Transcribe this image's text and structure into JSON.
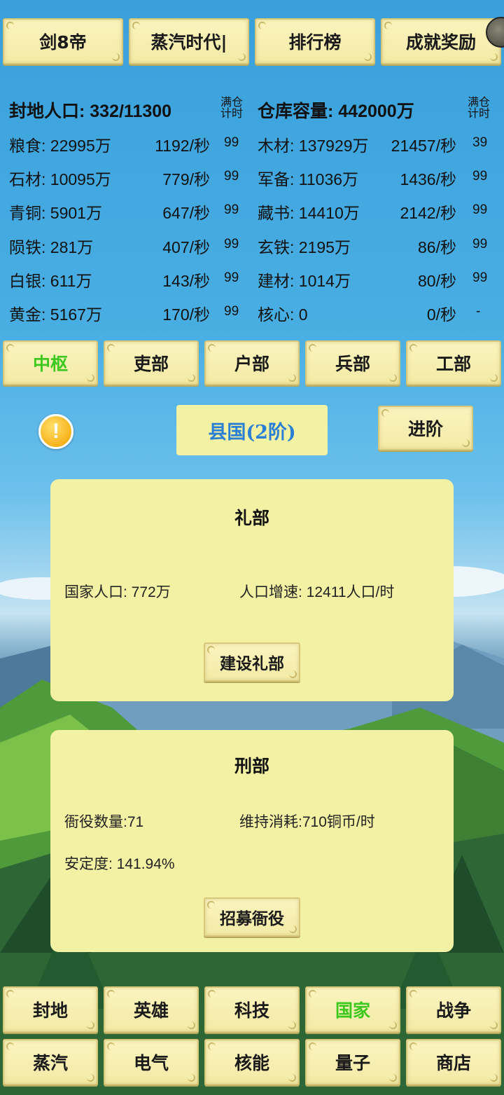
{
  "top_tabs": [
    "剑8帝",
    "蒸汽时代|",
    "排行榜",
    "成就奖励"
  ],
  "resources": {
    "header_left": "封地人口: 332/11300",
    "header_mid": "满仓\n计时",
    "header_right": "仓库容量: 442000万",
    "header_far": "满仓\n计时",
    "rows": [
      {
        "l_name": "粮食: 22995万",
        "l_rate": "1192/秒",
        "l_full": "99",
        "r_name": "木材: 137929万",
        "r_rate": "21457/秒",
        "r_full": "39"
      },
      {
        "l_name": "石材: 10095万",
        "l_rate": "779/秒",
        "l_full": "99",
        "r_name": "军备: 11036万",
        "r_rate": "1436/秒",
        "r_full": "99"
      },
      {
        "l_name": "青铜: 5901万",
        "l_rate": "647/秒",
        "l_full": "99",
        "r_name": "藏书: 14410万",
        "r_rate": "2142/秒",
        "r_full": "99"
      },
      {
        "l_name": "陨铁: 281万",
        "l_rate": "407/秒",
        "l_full": "99",
        "r_name": "玄铁: 2195万",
        "r_rate": "86/秒",
        "r_full": "99"
      },
      {
        "l_name": "白银: 611万",
        "l_rate": "143/秒",
        "l_full": "99",
        "r_name": "建材: 1014万",
        "r_rate": "80/秒",
        "r_full": "99"
      },
      {
        "l_name": "黄金: 5167万",
        "l_rate": "170/秒",
        "l_full": "99",
        "r_name": "核心: 0",
        "r_rate": "0/秒",
        "r_full": "-"
      }
    ]
  },
  "dept_tabs": [
    "中枢",
    "吏部",
    "户部",
    "兵部",
    "工部"
  ],
  "dept_active_color": "#3cc81e",
  "rank": {
    "label": "县国(2阶)",
    "advance_button": "进阶",
    "warn_symbol": "!"
  },
  "rites_panel": {
    "title": "礼部",
    "population": "国家人口: 772万",
    "growth": "人口增速: 12411人口/时",
    "button": "建设礼部"
  },
  "justice_panel": {
    "title": "刑部",
    "officers": "衙役数量:71",
    "upkeep": "维持消耗:710铜币/时",
    "stability": "安定度: 141.94%",
    "button": "招募衙役"
  },
  "bottom_nav_row1": [
    "封地",
    "英雄",
    "科技",
    "国家",
    "战争"
  ],
  "bottom_nav_row2": [
    "蒸汽",
    "电气",
    "核能",
    "量子",
    "商店"
  ],
  "active_nav_color": "#3cc81e"
}
